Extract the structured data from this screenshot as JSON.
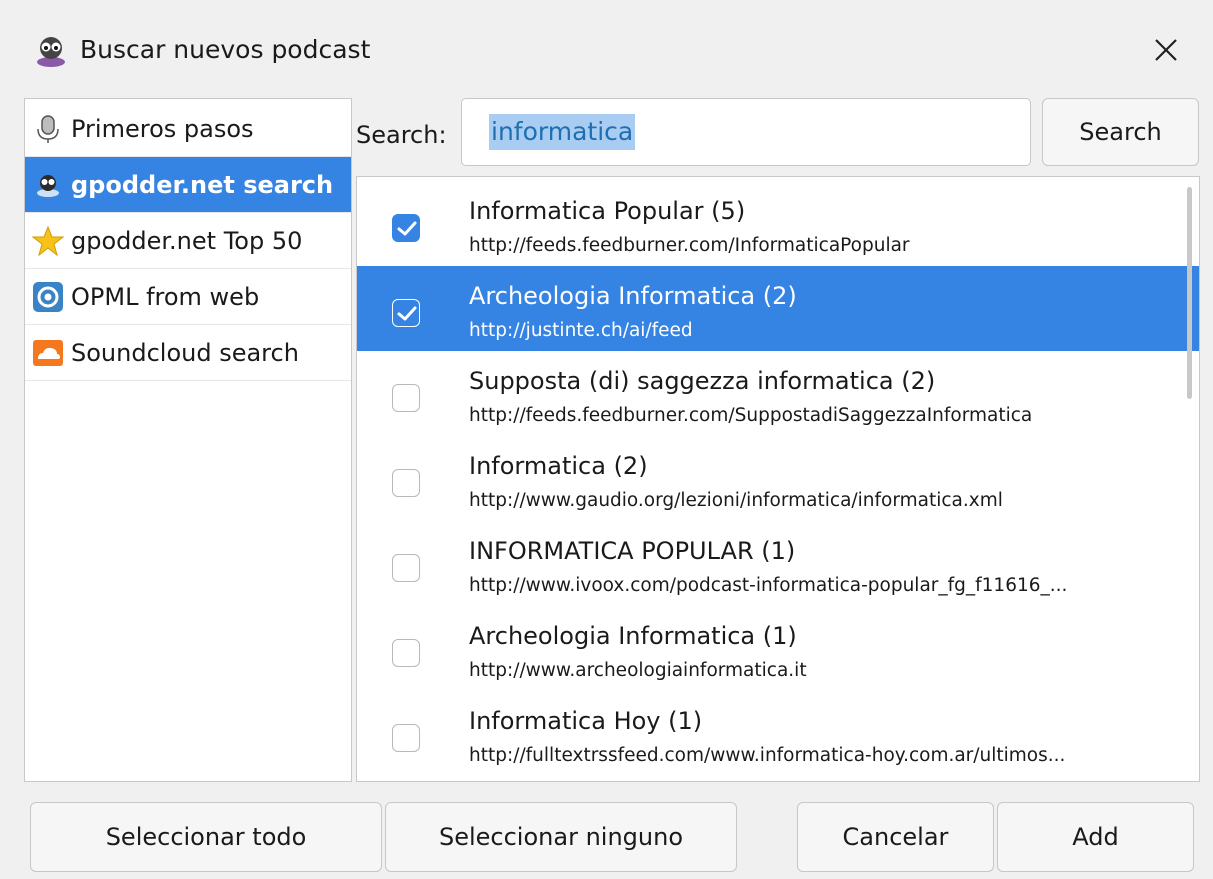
{
  "window": {
    "title": "Buscar nuevos podcast",
    "app_icon": "gpodder-icon",
    "close_icon": "close-icon"
  },
  "sidebar": {
    "items": [
      {
        "label": "Primeros pasos",
        "icon": "microphone-icon",
        "selected": false
      },
      {
        "label": "gpodder.net search",
        "icon": "gpodder-icon",
        "selected": true
      },
      {
        "label": "gpodder.net Top 50",
        "icon": "star-icon",
        "selected": false
      },
      {
        "label": "OPML from web",
        "icon": "opml-icon",
        "selected": false
      },
      {
        "label": "Soundcloud search",
        "icon": "soundcloud-icon",
        "selected": false
      }
    ]
  },
  "search": {
    "label": "Search:",
    "value": "informatica",
    "button_label": "Search"
  },
  "results": [
    {
      "title": "Informatica Popular (5)",
      "url": "http://feeds.feedburner.com/InformaticaPopular",
      "checked": true,
      "selected": false
    },
    {
      "title": "Archeologia Informatica (2)",
      "url": "http://justinte.ch/ai/feed",
      "checked": true,
      "selected": true
    },
    {
      "title": "Supposta (di) saggezza informatica (2)",
      "url": "http://feeds.feedburner.com/SuppostadiSaggezzaInformatica",
      "checked": false,
      "selected": false
    },
    {
      "title": "Informatica (2)",
      "url": "http://www.gaudio.org/lezioni/informatica/informatica.xml",
      "checked": false,
      "selected": false
    },
    {
      "title": "INFORMATICA POPULAR (1)",
      "url": "http://www.ivoox.com/podcast-informatica-popular_fg_f11616_...",
      "checked": false,
      "selected": false
    },
    {
      "title": "Archeologia Informatica (1)",
      "url": "http://www.archeologiainformatica.it",
      "checked": false,
      "selected": false
    },
    {
      "title": "Informatica Hoy (1)",
      "url": "http://fulltextrssfeed.com/www.informatica-hoy.com.ar/ultimos...",
      "checked": false,
      "selected": false
    }
  ],
  "footer": {
    "select_all_label": "Seleccionar todo",
    "select_none_label": "Seleccionar ninguno",
    "cancel_label": "Cancelar",
    "add_label": "Add"
  },
  "colors": {
    "accent": "#3584e4",
    "selection_text": "#ffffff",
    "search_highlight": "#a9cdf2"
  }
}
